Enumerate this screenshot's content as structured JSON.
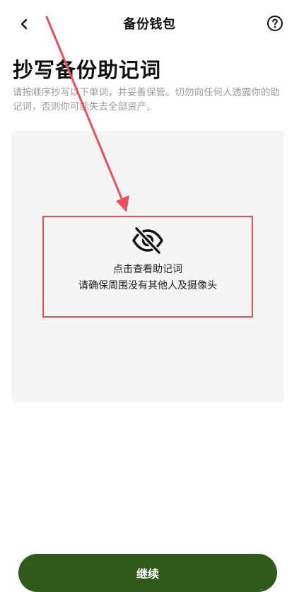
{
  "header": {
    "back_icon": "chevron-left-icon",
    "title": "备份钱包",
    "help_icon": "question-circle-icon"
  },
  "main": {
    "heading": "抄写备份助记词",
    "description": "请按顺序抄写以下单词，并妥善保管。切勿向任何人透露你的助记词，否则你可能失去全部资产。",
    "reveal": {
      "icon": "eye-off-icon",
      "line1": "点击查看助记词",
      "line2": "请确保周围没有其他人及摄像头"
    }
  },
  "footer": {
    "continue_label": "继续"
  },
  "colors": {
    "primary_button": "#2f5a1c",
    "annotation": "#e8505b",
    "card_background": "#f5f5f5",
    "muted_text": "#9a9a9a"
  }
}
